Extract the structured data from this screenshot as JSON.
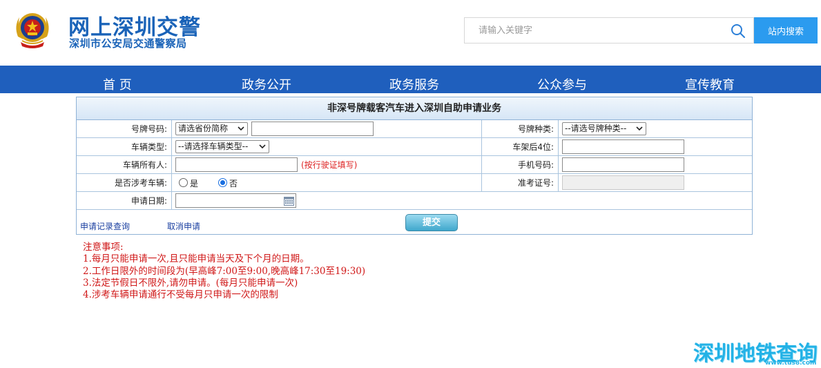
{
  "header": {
    "site_title": "网上深圳交警",
    "site_subtitle": "深圳市公安局交通警察局",
    "search_placeholder": "请输入关键字",
    "search_button": "站内搜索"
  },
  "nav": {
    "items": [
      "首 页",
      "政务公开",
      "政务服务",
      "公众参与",
      "宣传教育"
    ]
  },
  "form": {
    "title": "非深号牌载客汽车进入深圳自助申请业务",
    "plate_number_label": "号牌号码:",
    "province_select": "请选省份简称",
    "plate_type_label": "号牌种类:",
    "plate_type_select": "--请选号牌种类--",
    "vehicle_type_label": "车辆类型:",
    "vehicle_type_select": "--请选择车辆类型--",
    "frame_last4_label": "车架后4位:",
    "owner_label": "车辆所有人:",
    "owner_hint": "(按行驶证填写)",
    "phone_label": "手机号码:",
    "exam_vehicle_label": "是否涉考车辆:",
    "radio_yes": "是",
    "radio_no": "否",
    "radio_selected": "否",
    "exam_cert_label": "准考证号:",
    "apply_date_label": "申请日期:",
    "records_link": "申请记录查询",
    "cancel_link": "取消申请",
    "submit_button": "提交"
  },
  "notes": {
    "title": "注意事项:",
    "items": [
      "1.每月只能申请一次,且只能申请当天及下个月的日期。",
      "2.工作日限外的时间段为(早高峰7:00至9:00,晚高峰17:30至19:30)",
      "3.法定节假日不限外,请勿申请。(每月只能申请一次)",
      "4.涉考车辆申请通行不受每月只申请一次的限制"
    ]
  },
  "watermark": {
    "main": "深圳地铁查询",
    "url": "www.tus8.com"
  },
  "colors": {
    "brand_blue": "#1a63b8",
    "nav_bg": "#1f5fbd",
    "search_button_bg": "#2b9bef",
    "notice_red": "#d01818",
    "watermark": "#23b2e6"
  }
}
